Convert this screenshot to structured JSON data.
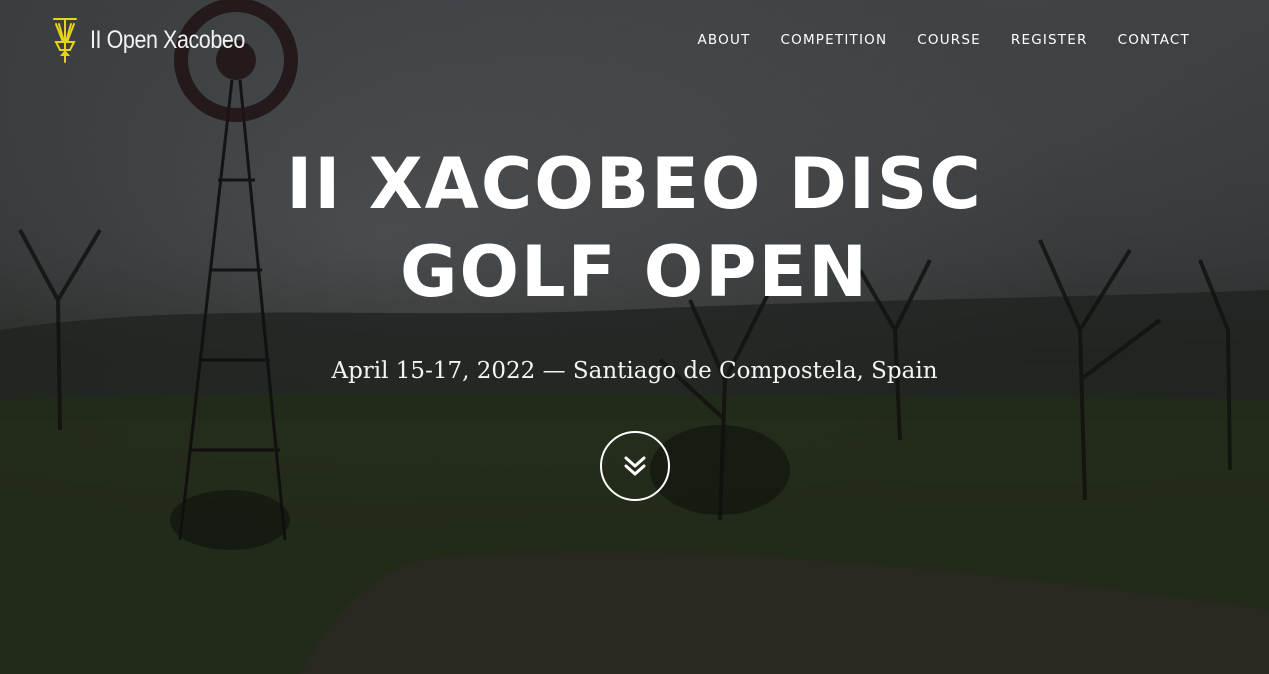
{
  "brand": {
    "name": "II Open Xacobeo",
    "logo_icon": "disc-golf-basket-icon",
    "logo_color": "#e8d31c"
  },
  "nav": {
    "items": [
      {
        "label": "ABOUT"
      },
      {
        "label": "COMPETITION"
      },
      {
        "label": "COURSE"
      },
      {
        "label": "REGISTER"
      },
      {
        "label": "CONTACT"
      }
    ]
  },
  "hero": {
    "title_line1": "II XACOBEO DISC",
    "title_line2": "GOLF OPEN",
    "subtitle": "April 15-17, 2022 — Santiago de Compostela, Spain",
    "scroll_icon": "chevron-double-down-icon"
  }
}
